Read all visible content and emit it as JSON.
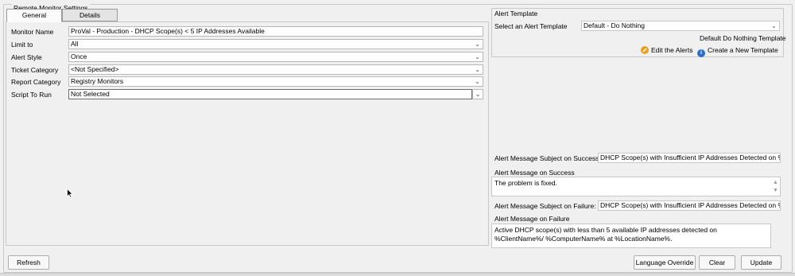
{
  "window": {
    "group_title": "Remote Monitor Settings"
  },
  "tabs": [
    {
      "label": "General",
      "active": true
    },
    {
      "label": "Details",
      "active": false
    }
  ],
  "form": {
    "monitor_name": {
      "label": "Monitor Name",
      "value": "ProVal - Production - DHCP Scope(s) < 5 IP Addresses Available"
    },
    "limit_to": {
      "label": "Limit to",
      "value": "All"
    },
    "alert_style": {
      "label": "Alert Style",
      "value": "Once"
    },
    "ticket_category": {
      "label": "Ticket Category",
      "value": "<Not Specified>"
    },
    "report_category": {
      "label": "Report Category",
      "value": "Registry Monitors"
    },
    "script_to_run": {
      "label": "Script To Run",
      "value": "Not Selected"
    }
  },
  "alert_template": {
    "group_title": "Alert Template",
    "select_label": "Select an Alert Template",
    "selected_value": "Default - Do Nothing",
    "template_description": "Default Do Nothing Template",
    "edit_alerts_label": "Edit the Alerts",
    "create_template_label": "Create a New Template"
  },
  "alert_messages": {
    "subject_success_label": "Alert Message Subject on Success:",
    "subject_success_value": "DHCP Scope(s) with Insufficient IP Addresses Detected on %comp",
    "message_success_label": "Alert Message on Success",
    "message_success_value": "The problem is fixed.",
    "subject_failure_label": "Alert Message Subject on Failure:",
    "subject_failure_value": "DHCP Scope(s) with Insufficient IP Addresses Detected on %comp",
    "message_failure_label": "Alert Message on Failure",
    "message_failure_value": "Active DHCP scope(s) with less than 5 available IP addresses detected on %ClientName%/ %ComputerName% at %LocationName%."
  },
  "buttons": {
    "refresh": "Refresh",
    "language_override": "Language Override",
    "clear": "Clear",
    "update": "Update"
  },
  "icons": {
    "edit_alerts": "edit-pencil-icon",
    "create_template": "info-icon",
    "dropdown": "chevron-down-icon",
    "cursor": "mouse-pointer-icon"
  },
  "colors": {
    "edit_icon": "#e8a020",
    "info_icon": "#2a6fc9"
  }
}
